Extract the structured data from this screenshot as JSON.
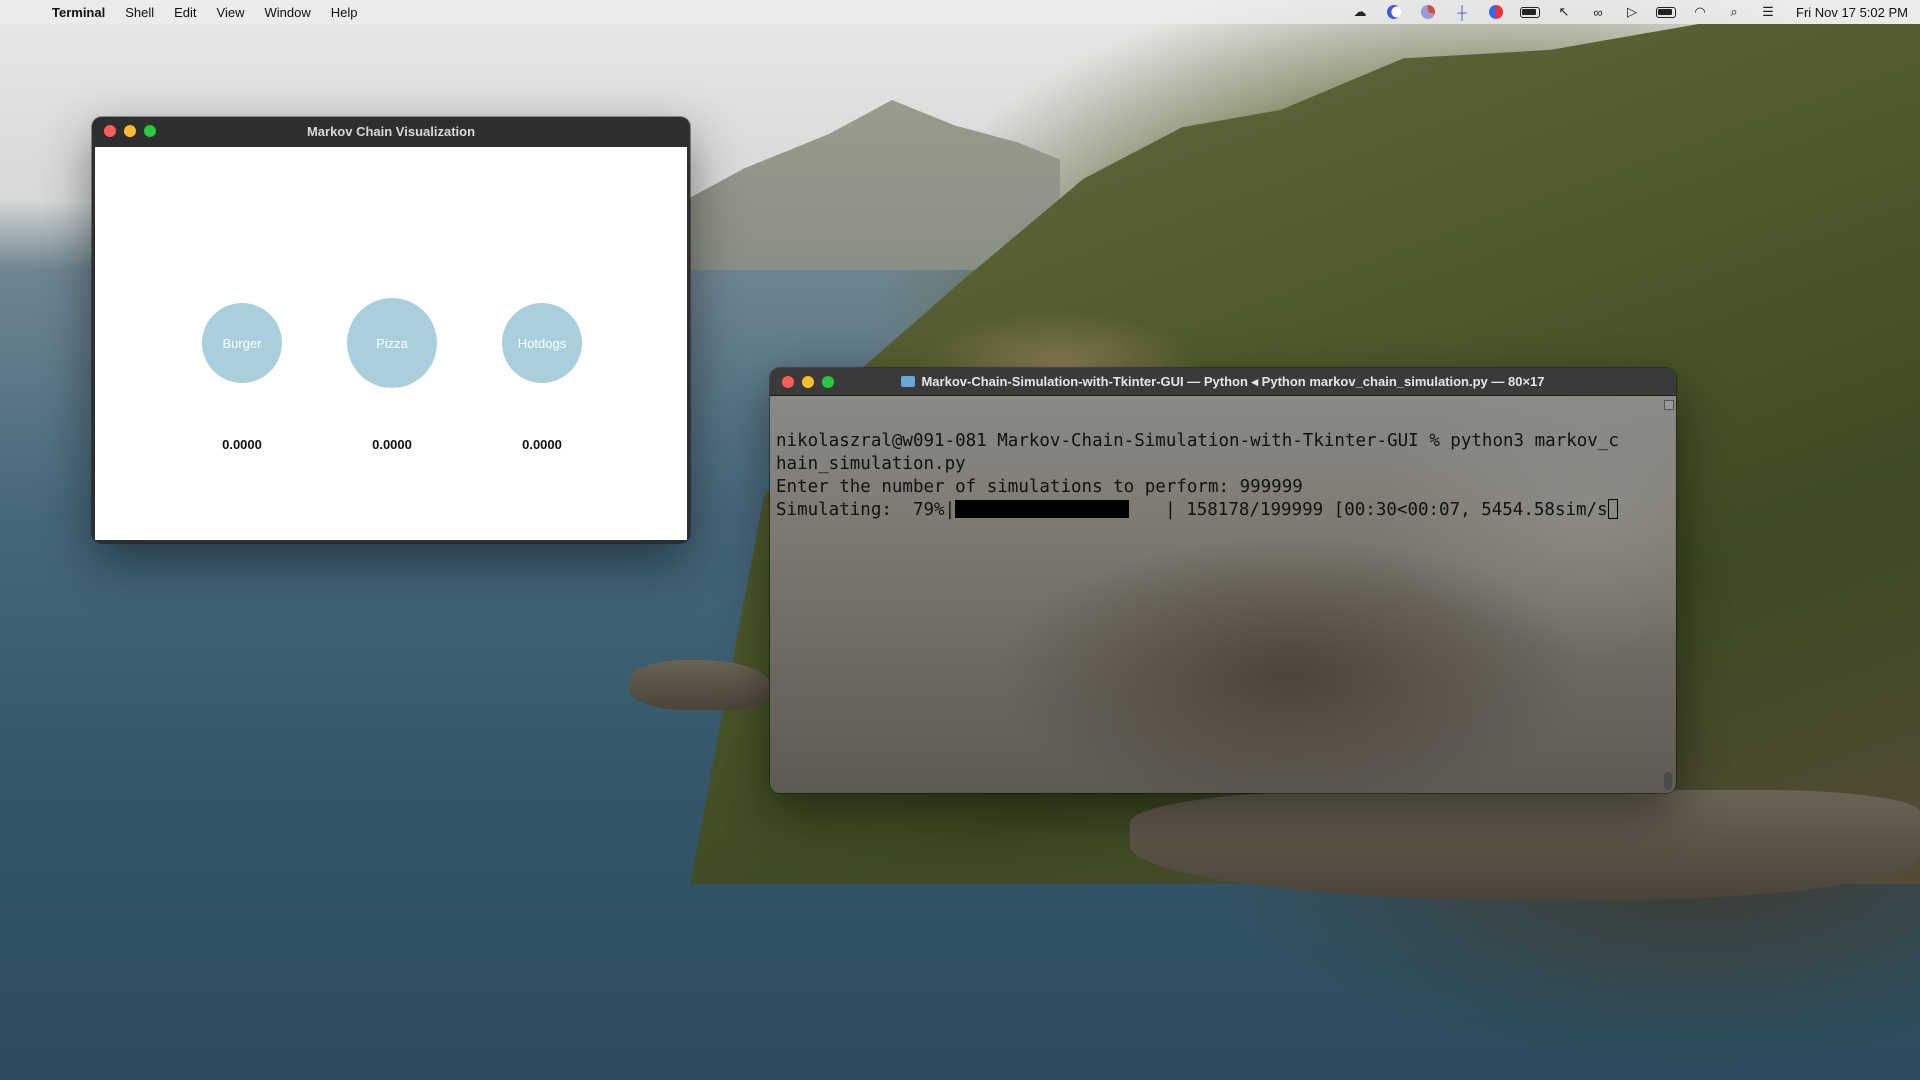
{
  "menubar": {
    "app_name": "Terminal",
    "items": [
      "Shell",
      "Edit",
      "View",
      "Window",
      "Help"
    ],
    "clock": "Fri Nov 17  5:02 PM"
  },
  "markov_window": {
    "title": "Markov Chain Visualization",
    "nodes": [
      {
        "label": "Burger",
        "value": "0.0000"
      },
      {
        "label": "Pizza",
        "value": "0.0000"
      },
      {
        "label": "Hotdogs",
        "value": "0.0000"
      }
    ]
  },
  "terminal_window": {
    "title": "Markov-Chain-Simulation-with-Tkinter-GUI — Python ◂ Python markov_chain_simulation.py — 80×17",
    "line1": "nikolaszral@w091-081 Markov-Chain-Simulation-with-Tkinter-GUI % python3 markov_c",
    "line2": "hain_simulation.py",
    "line3": "Enter the number of simulations to perform: 999999",
    "line4_prefix": "Simulating:  79%|",
    "line4_suffix": "| 158178/199999 [00:30<00:07, 5454.58sim/s",
    "progress_fraction": 0.79
  },
  "colors": {
    "node_fill": "#a9cfdd",
    "close": "#fe5f57",
    "minimize": "#febc2e",
    "zoom": "#28c840"
  }
}
